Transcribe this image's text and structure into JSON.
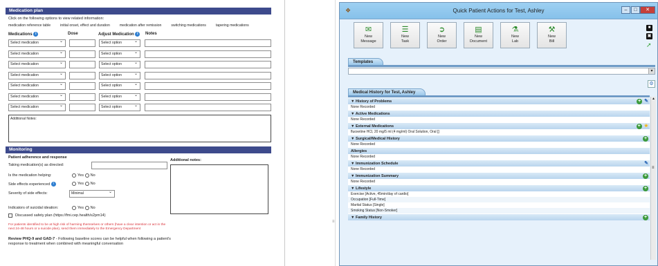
{
  "left": {
    "med_plan_title": "Medication plan",
    "instruction": "Click on the following options to view related information:",
    "links": [
      "medication reference table",
      "initial onset, effect and duration",
      "medication after remission",
      "switching medications",
      "tapering medications"
    ],
    "col_medications": "Medications",
    "col_dose": "Dose",
    "col_adjust": "Adjust Medication",
    "col_notes": "Notes",
    "rows": [
      {
        "med": "Select medication",
        "adj": "Select option"
      },
      {
        "med": "Select medication",
        "adj": "Select option"
      },
      {
        "med": "Select medication",
        "adj": "Select option"
      },
      {
        "med": "Select medication",
        "adj": "Select option"
      },
      {
        "med": "Select medication",
        "adj": "Select option"
      },
      {
        "med": "Select medication",
        "adj": "Select option"
      },
      {
        "med": "Select medication",
        "adj": "Select option"
      }
    ],
    "additional_notes_label": "Additional Notes:",
    "monitoring_title": "Monitoring",
    "adherence_title": "Patient adherence and response",
    "taking_label": "Taking medication(s) as directed:",
    "helping_label": "Is the medication helping:",
    "side_effects_label": "Side effects experienced",
    "severity_label": "Severity of side effects:",
    "severity_value": "Minimal",
    "yes": "Yes",
    "no": "No",
    "suicidal_label": "Indicators of suicidal ideation:",
    "safety_plan": "Discussed safety plan (https://fmi.cep.health/s2pm14)",
    "red_text": "For patients identified to be at high risk of harming themselves or others (have a clear intention or act in the next 24-48 hours or a suicide plan), send them immediately to the Emergency Department",
    "review_bold": "Review PHQ-9 and GAD-7",
    "review_text": " - Following baseline scores can be helpful when following a patient's response to treatment when combined with meaningful conversation",
    "additional_notes2": "Additional notes:"
  },
  "window": {
    "title": "Quick Patient Actions for Test, Ashley",
    "buttons": [
      {
        "icon": "message-icon",
        "l1": "New",
        "l2": "Message"
      },
      {
        "icon": "task-icon",
        "l1": "New",
        "l2": "Task"
      },
      {
        "icon": "order-icon",
        "l1": "New",
        "l2": "Order"
      },
      {
        "icon": "document-icon",
        "l1": "New",
        "l2": "Document"
      },
      {
        "icon": "lab-icon",
        "l1": "New",
        "l2": "Lab"
      },
      {
        "icon": "bill-icon",
        "l1": "New",
        "l2": "Bill"
      }
    ],
    "templates_tab": "Templates",
    "history_tab": "Medical History for Test, Ashley",
    "sections": [
      {
        "name": "History of Problems",
        "body": [
          "None Recorded"
        ]
      },
      {
        "name": "Active Medications",
        "body": [
          "None Recorded"
        ]
      },
      {
        "name": "External Medications",
        "body": [
          "fluoxetine HCl, 20 mg/5 ml (4 mg/ml) Oral Solution, Oral []"
        ]
      },
      {
        "name": "Surgical/Medical History",
        "body": [
          "None Recorded"
        ]
      },
      {
        "name": "Allergies",
        "body": [
          "None Recorded"
        ]
      },
      {
        "name": "Immunization Schedule",
        "body": [
          "None Recorded"
        ]
      },
      {
        "name": "Immunization Summary",
        "body": [
          "None Recorded"
        ]
      },
      {
        "name": "Lifestyle",
        "body": [
          "Exercise [Active, 45min/day of cardio]",
          "Occupation [Full-Time]",
          "Marital Status [Single]",
          "Smoking Status [Non-Smoker]"
        ]
      },
      {
        "name": "Family History",
        "body": []
      }
    ]
  }
}
